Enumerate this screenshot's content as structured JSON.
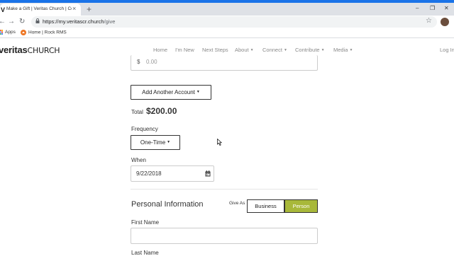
{
  "browser": {
    "tab_title": "Make a Gift | Veritas Church | Co",
    "tab_close": "×",
    "new_tab": "+",
    "url_host": "https://my.veritascr.church",
    "url_path": "/give",
    "bookmarks": [
      {
        "label": "Apps"
      },
      {
        "label": "Home | Rock RMS"
      }
    ],
    "controls": {
      "minimize": "–",
      "restore": "❐",
      "close": "✕"
    }
  },
  "site": {
    "logo_bold": "veritas",
    "logo_light": "CHURCH",
    "nav": [
      {
        "label": "Home"
      },
      {
        "label": "I'm New"
      },
      {
        "label": "Next Steps"
      },
      {
        "label": "About",
        "caret": "▼"
      },
      {
        "label": "Connect",
        "caret": "▼"
      },
      {
        "label": "Contribute",
        "caret": "▼"
      },
      {
        "label": "Media",
        "caret": "▼"
      },
      {
        "label": "Log In"
      }
    ]
  },
  "form": {
    "amount": {
      "symbol": "$",
      "placeholder": "0.00"
    },
    "add_account_label": "Add Another Account",
    "total_label": "Total",
    "total_value": "$200.00",
    "frequency_label": "Frequency",
    "frequency_value": "One-Time",
    "when_label": "When",
    "when_value": "9/22/2018",
    "personal_info_title": "Personal Information",
    "give_as_label": "Give As",
    "give_as_options": [
      "Business",
      "Person"
    ],
    "give_as_selected": "Person",
    "first_name_label": "First Name",
    "last_name_label": "Last Name"
  },
  "colors": {
    "accent": "#a8b83a",
    "chrome_blue": "#1a73e8"
  }
}
